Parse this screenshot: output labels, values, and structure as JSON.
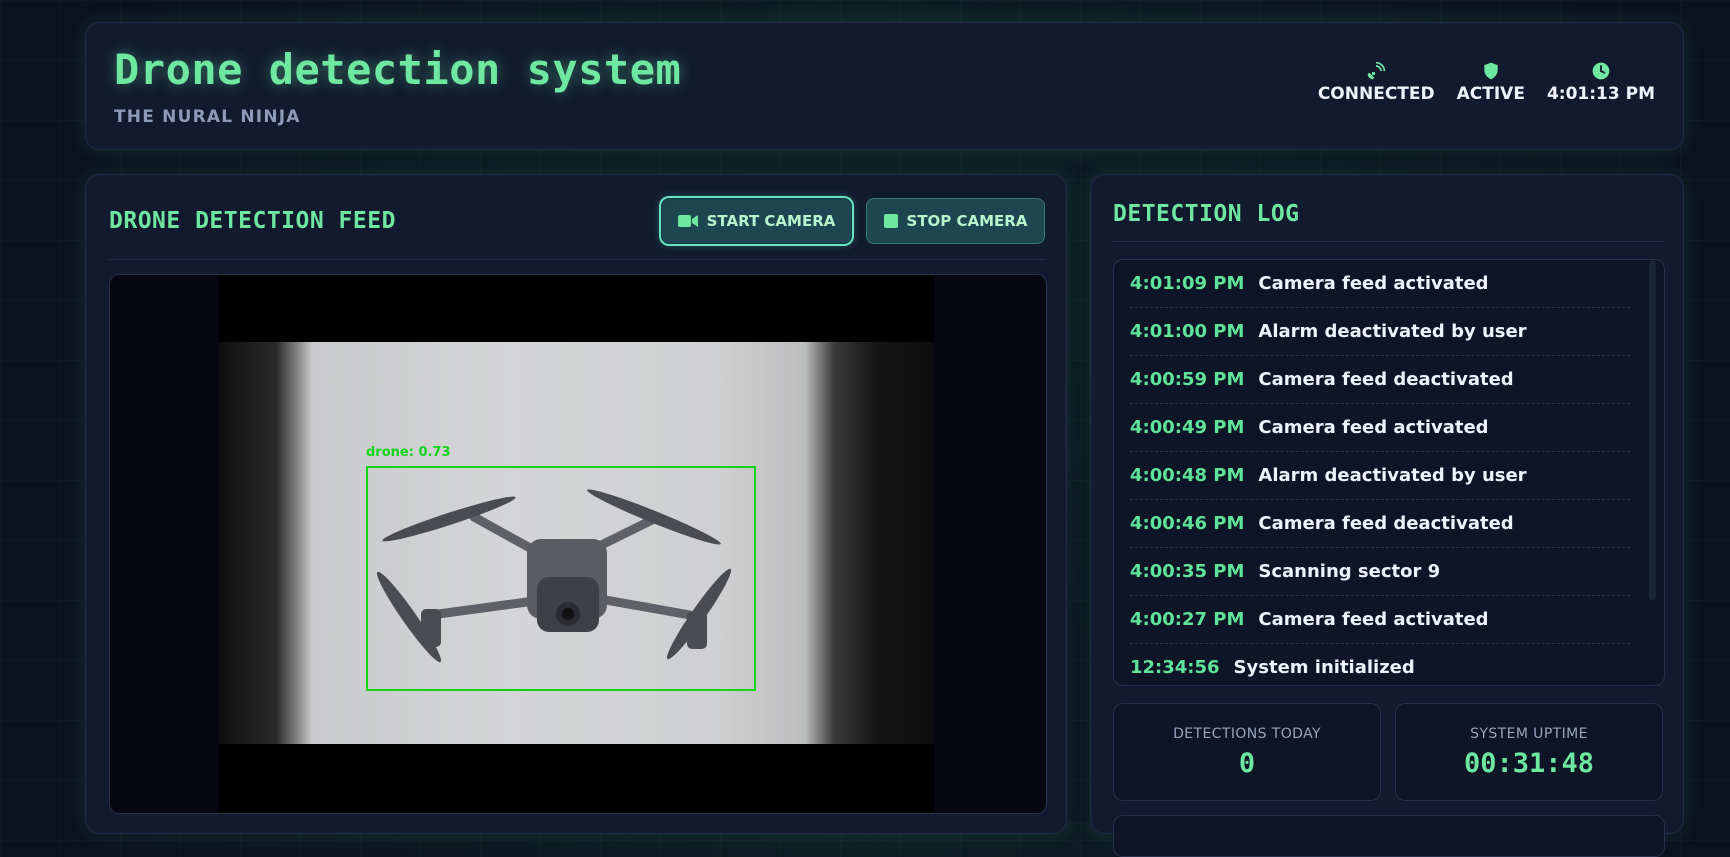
{
  "header": {
    "title": "Drone detection system",
    "subtitle": "THE NURAL NINJA",
    "status": [
      {
        "icon": "satellite-dish-icon",
        "label": "CONNECTED"
      },
      {
        "icon": "shield-icon",
        "label": "ACTIVE"
      },
      {
        "icon": "clock-icon",
        "label": "4:01:13 PM"
      }
    ]
  },
  "feed": {
    "title": "DRONE DETECTION FEED",
    "start_label": "START CAMERA",
    "stop_label": "STOP CAMERA",
    "detection_label": "drone: 0.73"
  },
  "log": {
    "title": "DETECTION LOG",
    "entries": [
      {
        "time": "4:01:09 PM",
        "message": "Camera feed activated"
      },
      {
        "time": "4:01:00 PM",
        "message": "Alarm deactivated by user"
      },
      {
        "time": "4:00:59 PM",
        "message": "Camera feed deactivated"
      },
      {
        "time": "4:00:49 PM",
        "message": "Camera feed activated"
      },
      {
        "time": "4:00:48 PM",
        "message": "Alarm deactivated by user"
      },
      {
        "time": "4:00:46 PM",
        "message": "Camera feed deactivated"
      },
      {
        "time": "4:00:35 PM",
        "message": "Scanning sector 9"
      },
      {
        "time": "4:00:27 PM",
        "message": "Camera feed activated"
      },
      {
        "time": "12:34:56",
        "message": "System initialized"
      }
    ]
  },
  "stats": {
    "detections_label": "DETECTIONS TODAY",
    "detections_value": "0",
    "uptime_label": "SYSTEM UPTIME",
    "uptime_value": "00:31:48"
  },
  "colors": {
    "accent": "#6ee7a0",
    "detection_box": "#14d41a",
    "panel": "#111a2e",
    "background": "#0b1220"
  }
}
